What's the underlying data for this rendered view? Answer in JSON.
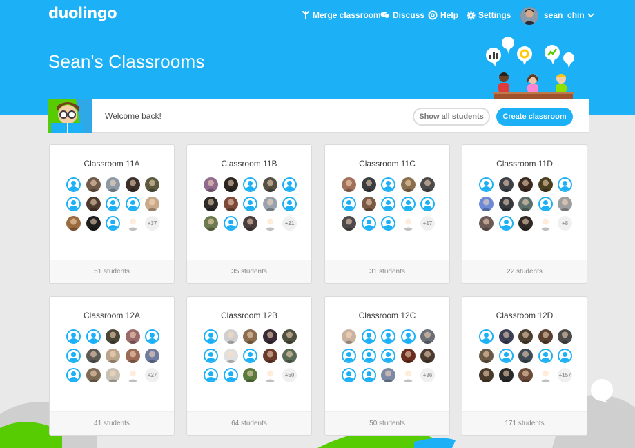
{
  "app": {
    "logo": "duolingo"
  },
  "nav": {
    "merge": "Merge classroom",
    "discuss": "Discuss",
    "help": "Help",
    "settings": "Settings",
    "username": "sean_chin"
  },
  "page": {
    "title": "Sean's Classrooms"
  },
  "welcome": {
    "text": "Welcome back!",
    "show_all": "Show all students",
    "create": "Create classroom"
  },
  "colors": {
    "brand": "#1cb0f6",
    "background": "#e9e9e9"
  },
  "icons": [
    "merge-icon",
    "discuss-icon",
    "help-icon",
    "gear-icon",
    "chevron-down-icon",
    "default-avatar-icon"
  ],
  "classrooms": [
    {
      "name": "Classroom 11A",
      "students": "51 students",
      "more": "+37",
      "avatars": [
        "d",
        "#6f5a48",
        "#8d9aa6",
        "#3a3029",
        "#5c5a3e",
        "d",
        "#4d3a2c",
        "d",
        "d",
        "#c9a98c",
        "#9a6b3f",
        "#1e1e1e",
        "d"
      ]
    },
    {
      "name": "Classroom 11B",
      "students": "35 students",
      "more": "+21",
      "avatars": [
        "#8f6a8c",
        "#2d2520",
        "d",
        "#555046",
        "d",
        "#2e2a28",
        "#7b4a3a",
        "d",
        "#9aa3ad",
        "d",
        "#6b7a4f",
        "d",
        "#4a3d3d"
      ]
    },
    {
      "name": "Classroom 11C",
      "students": "31 students",
      "more": "+17",
      "avatars": [
        "#a1705a",
        "#3a3c3f",
        "d",
        "#8a6f4e",
        "#4b4b4b",
        "d",
        "#7a5a45",
        "d",
        "d",
        "d",
        "#4f4a4a",
        "d",
        "d"
      ]
    },
    {
      "name": "Classroom 11D",
      "students": "22 students",
      "more": "+8",
      "avatars": [
        "d",
        "#3d4147",
        "#3a2a20",
        "#4a3f20",
        "d",
        "#6c8ad6",
        "#34393f",
        "#5b6e6a",
        "d",
        "#9e9e9e",
        "#6b5a55",
        "d",
        "#2f2a26"
      ]
    },
    {
      "name": "Classroom 12A",
      "students": "41 students",
      "more": "+27",
      "avatars": [
        "d",
        "d",
        "#4a4636",
        "#9a6a6a",
        "d",
        "d",
        "#5b5a55",
        "#b9a58c",
        "#9a6a55",
        "#6f7ca0",
        "d",
        "#7c6a55",
        "#c9c2b4"
      ]
    },
    {
      "name": "Classroom 12B",
      "students": "64 students",
      "more": "+50",
      "avatars": [
        "d",
        "#cfcfcf",
        "#8a6c4e",
        "#3a2a35",
        "#4f4f3e",
        "d",
        "#e0e0e0",
        "d",
        "#6b3a2a",
        "#5b6a55",
        "d",
        "d",
        "#5a7a3e"
      ]
    },
    {
      "name": "Classroom 12C",
      "students": "50 students",
      "more": "+36",
      "avatars": [
        "#c9b3a0",
        "d",
        "d",
        "d",
        "#6b6f77",
        "d",
        "d",
        "d",
        "#6a2e20",
        "#4a3a30",
        "d",
        "d",
        "#7c8aa6"
      ]
    },
    {
      "name": "Classroom 12D",
      "students": "171 students",
      "more": "+157",
      "avatars": [
        "d",
        "#3a3f55",
        "#4a3f30",
        "#5a4030",
        "#4b4b4b",
        "#6a5a45",
        "d",
        "#3d4a55",
        "d",
        "d",
        "#4a3a2a",
        "#2a2a2a",
        "#6a4a3a"
      ]
    }
  ]
}
